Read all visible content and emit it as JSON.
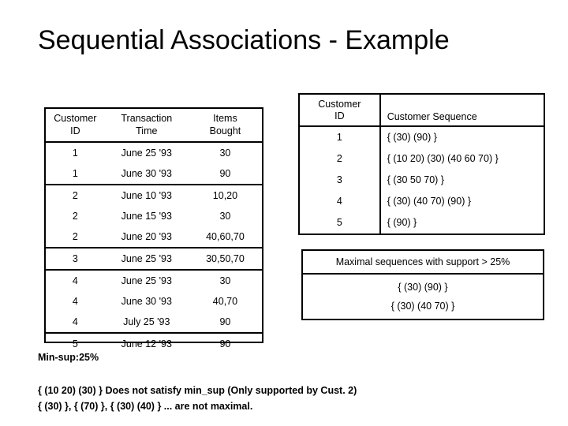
{
  "slide": {
    "title": "Sequential Associations - Example"
  },
  "transactions": {
    "headers": [
      "Customer\nID",
      "Transaction\nTime",
      "Items\nBought"
    ],
    "header_lines": [
      [
        "Customer",
        "ID"
      ],
      [
        "Transaction",
        "Time"
      ],
      [
        "Items",
        "Bought"
      ]
    ],
    "rows": [
      {
        "customer_id": "1",
        "time": "June 25 '93",
        "items": "30",
        "group_end": false
      },
      {
        "customer_id": "1",
        "time": "June 30 '93",
        "items": "90",
        "group_end": true
      },
      {
        "customer_id": "2",
        "time": "June 10 '93",
        "items": "10,20",
        "group_end": false
      },
      {
        "customer_id": "2",
        "time": "June 15 '93",
        "items": "30",
        "group_end": false
      },
      {
        "customer_id": "2",
        "time": "June 20 '93",
        "items": "40,60,70",
        "group_end": true
      },
      {
        "customer_id": "3",
        "time": "June 25 '93",
        "items": "30,50,70",
        "group_end": true
      },
      {
        "customer_id": "4",
        "time": "June 25 '93",
        "items": "30",
        "group_end": false
      },
      {
        "customer_id": "4",
        "time": "June 30 '93",
        "items": "40,70",
        "group_end": false
      },
      {
        "customer_id": "4",
        "time": "July 25 '93",
        "items": "90",
        "group_end": true
      },
      {
        "customer_id": "5",
        "time": "June 12 '93",
        "items": "90",
        "group_end": false
      }
    ]
  },
  "sequences": {
    "header_id_lines": [
      "Customer",
      "ID"
    ],
    "header_sequence": "Customer Sequence",
    "rows": [
      {
        "customer_id": "1",
        "sequence": "{ (30) (90) }"
      },
      {
        "customer_id": "2",
        "sequence": "{ (10 20) (30) (40 60 70) }"
      },
      {
        "customer_id": "3",
        "sequence": "{ (30 50 70) }"
      },
      {
        "customer_id": "4",
        "sequence": "{ (30) (40 70) (90) }"
      },
      {
        "customer_id": "5",
        "sequence": "{ (90) }"
      }
    ]
  },
  "maximal": {
    "header": "Maximal sequences with support > 25%",
    "lines": [
      "{ (30) (90) }",
      "{ (30) (40 70) }"
    ]
  },
  "footer": {
    "min_sup": "Min-sup:25%",
    "note_1": "{ (10 20) (30) } Does not satisfy min_sup (Only supported by Cust. 2)",
    "note_2": "{ (30) }, { (70) }, { (30) (40) } ... are not maximal."
  },
  "colors": {
    "background": "#ffffff",
    "text": "#000000",
    "border": "#000000"
  }
}
